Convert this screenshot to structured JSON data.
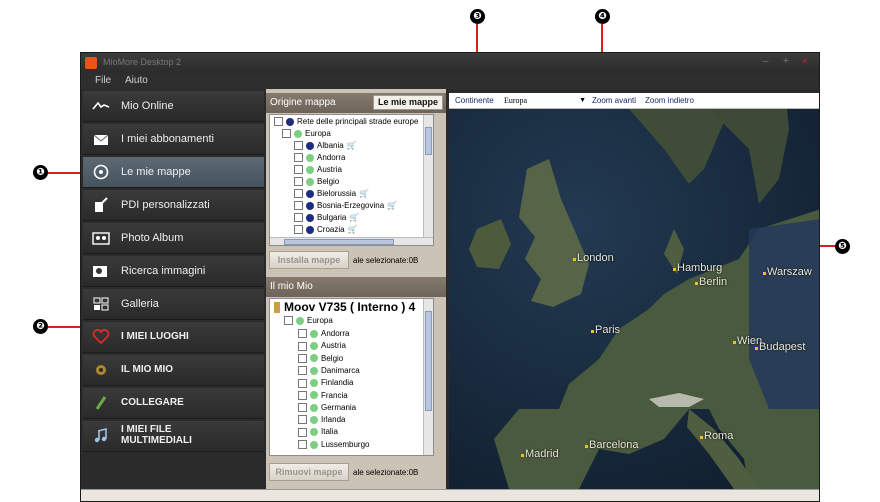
{
  "window": {
    "title": "MioMore Desktop 2"
  },
  "menu": [
    "File",
    "Aiuto"
  ],
  "nav": [
    {
      "label": "Mio Online",
      "icon": "mio-online-icon"
    },
    {
      "label": "I miei abbonamenti",
      "icon": "subscriptions-icon"
    },
    {
      "label": "Le mie mappe",
      "icon": "maps-disc-icon"
    },
    {
      "label": "PDI personalizzati",
      "icon": "custom-poi-icon"
    },
    {
      "label": "Photo Album",
      "icon": "photo-album-icon"
    },
    {
      "label": "Ricerca immagini",
      "icon": "image-search-icon"
    },
    {
      "label": "Galleria",
      "icon": "gallery-icon"
    },
    {
      "label": "I MIEI LUOGHI",
      "icon": "heart-icon"
    },
    {
      "label": "IL MIO MIO",
      "icon": "gear-icon"
    },
    {
      "label": "COLLEGARE",
      "icon": "connect-icon"
    },
    {
      "label": "I MIEI FILE MULTIMEDIALI",
      "icon": "music-icon"
    }
  ],
  "origin_panel": {
    "title": "Origine mappa",
    "button": "Le mie mappe",
    "items": [
      {
        "label": "Rete delle principali strade europe",
        "dot": "navy",
        "indent": 1
      },
      {
        "label": "Europa",
        "dot": "green",
        "indent": 0
      },
      {
        "label": "Albania",
        "dot": "navy",
        "indent": 2,
        "cart": true
      },
      {
        "label": "Andorra",
        "dot": "green",
        "indent": 2
      },
      {
        "label": "Austria",
        "dot": "green",
        "indent": 2
      },
      {
        "label": "Belgio",
        "dot": "green",
        "indent": 2
      },
      {
        "label": "Bielorussia",
        "dot": "navy",
        "indent": 2,
        "cart": true
      },
      {
        "label": "Bosnia-Erzegovina",
        "dot": "navy",
        "indent": 2,
        "cart": true
      },
      {
        "label": "Bulgaria",
        "dot": "navy",
        "indent": 2,
        "cart": true
      },
      {
        "label": "Croazia",
        "dot": "navy",
        "indent": 2,
        "cart": true
      }
    ],
    "install_button": "Installa mappe",
    "selected_text": "ale selezionate:0B"
  },
  "mio_panel": {
    "title": "Il mio Mio",
    "device": "Moov V735 ( Interno ) 4",
    "root": "Europa",
    "items": [
      "Andorra",
      "Austria",
      "Belgio",
      "Danimarca",
      "Finlandia",
      "Francia",
      "Germania",
      "Irlanda",
      "Italia",
      "Lussemburgo"
    ],
    "remove_button": "Rimuovi mappe",
    "selected_text": "ale selezionate:0B"
  },
  "toolbar": {
    "continent_label": "Continente",
    "continent_value": "Europa",
    "zoom_in": "Zoom avanti",
    "zoom_out": "Zoom indietro"
  },
  "map": {
    "cities": [
      {
        "name": "London",
        "key": "london"
      },
      {
        "name": "Paris",
        "key": "paris"
      },
      {
        "name": "Hamburg",
        "key": "hamburg"
      },
      {
        "name": "Berlin",
        "key": "berlin"
      },
      {
        "name": "Warszaw",
        "key": "warszaw"
      },
      {
        "name": "Wien",
        "key": "wien"
      },
      {
        "name": "Budapest",
        "key": "budapest"
      },
      {
        "name": "Madrid",
        "key": "madrid"
      },
      {
        "name": "Barcelona",
        "key": "barcelona"
      },
      {
        "name": "Roma",
        "key": "roma"
      }
    ]
  },
  "callouts": [
    "❶",
    "❷",
    "❸",
    "❹",
    "❺"
  ]
}
